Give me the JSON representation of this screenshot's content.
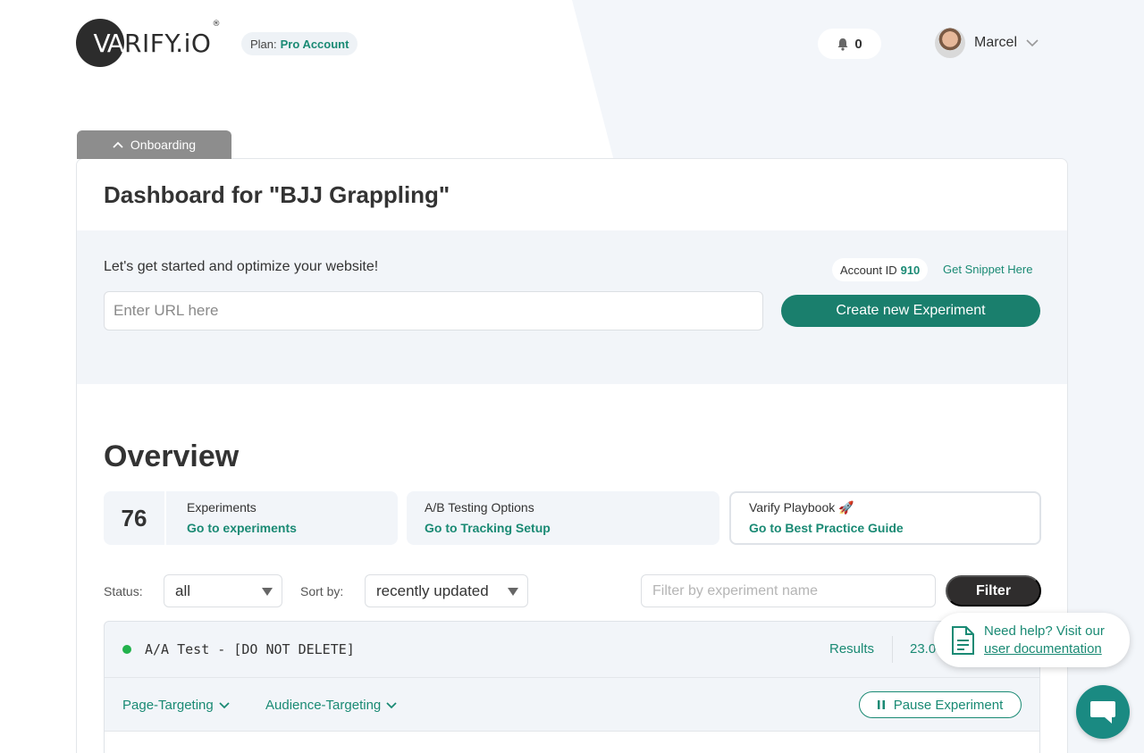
{
  "header": {
    "logo_mark": "VA",
    "logo_text": "RIFY.iO",
    "logo_reg": "®",
    "plan_label": "Plan:",
    "plan_value": "Pro Account",
    "notification_count": "0",
    "user_name": "Marcel"
  },
  "onboarding": {
    "tab_label": "Onboarding"
  },
  "dashboard": {
    "title": "Dashboard for \"BJJ Grappling\"",
    "start_text": "Let's get started and optimize your website!",
    "account_label": "Account ID",
    "account_id": "910",
    "snippet_link": "Get Snippet Here",
    "url_placeholder": "Enter URL here",
    "create_button": "Create new Experiment"
  },
  "overview": {
    "title": "Overview",
    "experiments_count": "76",
    "experiments_label": "Experiments",
    "experiments_link": "Go to experiments",
    "ab_label": "A/B Testing Options",
    "ab_link": "Go to Tracking Setup",
    "playbook_label": "Varify Playbook 🚀",
    "playbook_link": "Go to Best Practice Guide"
  },
  "filters": {
    "status_label": "Status:",
    "status_value": "all",
    "sort_label": "Sort by:",
    "sort_value": "recently updated",
    "filter_placeholder": "Filter by experiment name",
    "filter_button": "Filter"
  },
  "experiment": {
    "name": "A/A Test - [DO NOT DELETE]",
    "results_link": "Results",
    "date_partial": "23.0",
    "page_targeting": "Page-Targeting",
    "audience_targeting": "Audience-Targeting",
    "pause_button": "Pause Experiment",
    "status_color": "#22b24c"
  },
  "help": {
    "line1": "Need help? Visit our",
    "link": "user documentation"
  },
  "colors": {
    "accent": "#1a8a74",
    "primary_button": "#1a7f6d",
    "dark_button": "#2f2d2d"
  }
}
